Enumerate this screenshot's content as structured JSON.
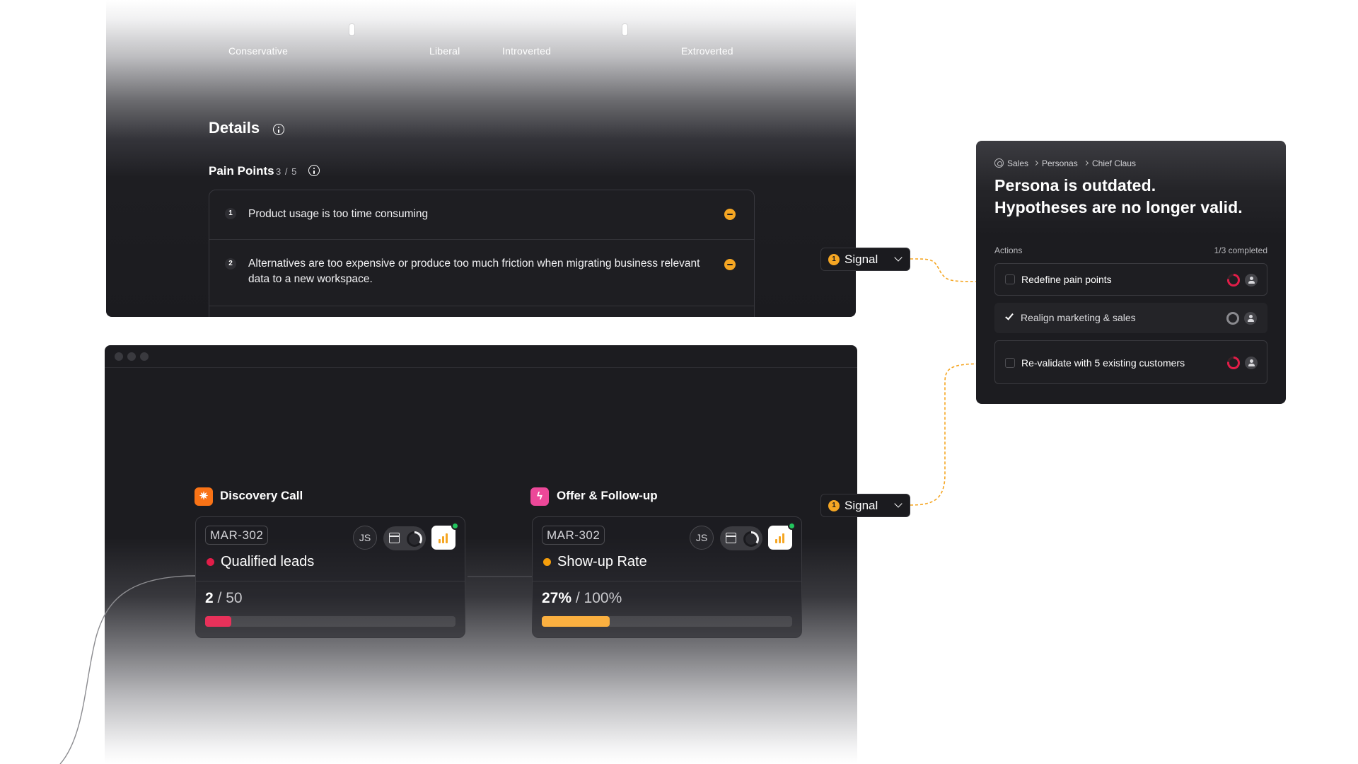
{
  "spectrum": {
    "labels": [
      "Conservative",
      "Liberal",
      "Introverted",
      "Extroverted"
    ]
  },
  "details": {
    "title": "Details",
    "pain_points_label": "Pain Points",
    "pain_points_count": "3 / 5",
    "items": [
      {
        "num": "1",
        "text": "Product usage is too time consuming"
      },
      {
        "num": "2",
        "text": "Alternatives are too expensive or produce too much friction when migrating business relevant data to a new workspace."
      }
    ]
  },
  "pipeline": {
    "stages": [
      {
        "title": "Discovery Call",
        "icon": "sparkle-icon",
        "icon_color": "#f97316",
        "card": {
          "tag": "MAR-302",
          "avatar": "JS",
          "metric_name": "Qualified leads",
          "status_color": "#e11d48",
          "value": "2",
          "total": " / 50",
          "progress_fraction": 0.04,
          "bar_color": "#e8315a"
        }
      },
      {
        "title": "Offer & Follow-up",
        "icon": "lightning-icon",
        "icon_color": "#ec4899",
        "card": {
          "tag": "MAR-302",
          "avatar": "JS",
          "metric_name": "Show-up Rate",
          "status_color": "#f59e0b",
          "value": "27%",
          "total": " / 100%",
          "progress_fraction": 0.27,
          "bar_color": "#fbb040"
        }
      }
    ]
  },
  "signals": [
    {
      "count": "1",
      "label": "Signal"
    },
    {
      "count": "1",
      "label": "Signal"
    }
  ],
  "persona": {
    "breadcrumb": [
      "Sales",
      "Personas",
      "Chief Claus"
    ],
    "headline_line1": "Persona is outdated.",
    "headline_line2": "Hypotheses are no longer valid.",
    "actions_label": "Actions",
    "actions_progress": "1/3 completed",
    "actions": [
      {
        "label": "Redefine pain points",
        "done": false,
        "status": "in-progress"
      },
      {
        "label": "Realign marketing & sales",
        "done": true,
        "status": "complete"
      },
      {
        "label": "Re-validate with 5 existing customers",
        "done": false,
        "status": "in-progress"
      }
    ]
  },
  "colors": {
    "accent_orange": "#f5a623",
    "alert_red": "#e11d48",
    "live_green": "#22c55e"
  }
}
